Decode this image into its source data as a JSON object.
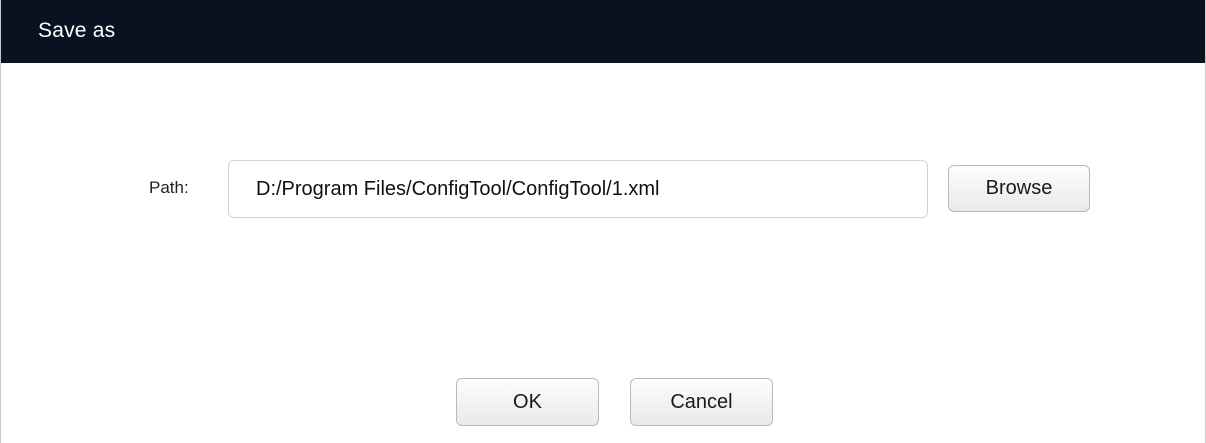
{
  "dialog": {
    "title": "Save as"
  },
  "path": {
    "label": "Path:",
    "value": "D:/Program Files/ConfigTool/ConfigTool/1.xml"
  },
  "buttons": {
    "browse": "Browse",
    "ok": "OK",
    "cancel": "Cancel"
  },
  "colors": {
    "titlebar": "#09131f",
    "title_text": "#ffffff",
    "background": "#ffffff"
  }
}
